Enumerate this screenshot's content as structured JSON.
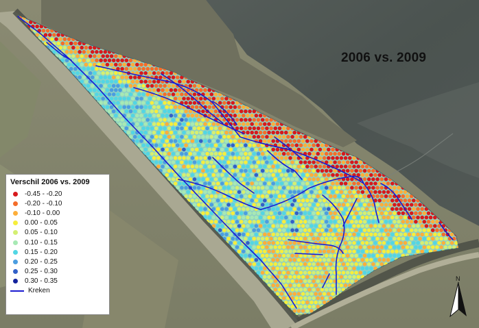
{
  "map": {
    "title": "2006 vs. 2009",
    "north_label": "N"
  },
  "legend": {
    "title": "Verschil 2006 vs. 2009",
    "classes": [
      {
        "label": "-0.45 - -0.20",
        "color": "#d7191c"
      },
      {
        "label": "-0.20 - -0.10",
        "color": "#f46d2a"
      },
      {
        "label": "-0.10 - 0.00",
        "color": "#fdae3a"
      },
      {
        "label": "0.00 - 0.05",
        "color": "#f6ee3c"
      },
      {
        "label": "0.05 - 0.10",
        "color": "#d4ef72"
      },
      {
        "label": "0.10 - 0.15",
        "color": "#a7e9b4"
      },
      {
        "label": "0.15 - 0.20",
        "color": "#52d6e4"
      },
      {
        "label": "0.20 - 0.25",
        "color": "#4b9de0"
      },
      {
        "label": "0.25 - 0.30",
        "color": "#3260c8"
      },
      {
        "label": "0.30 - 0.35",
        "color": "#13239c"
      }
    ],
    "line_item": {
      "label": "Kreken",
      "color": "#1a1ad0"
    }
  }
}
